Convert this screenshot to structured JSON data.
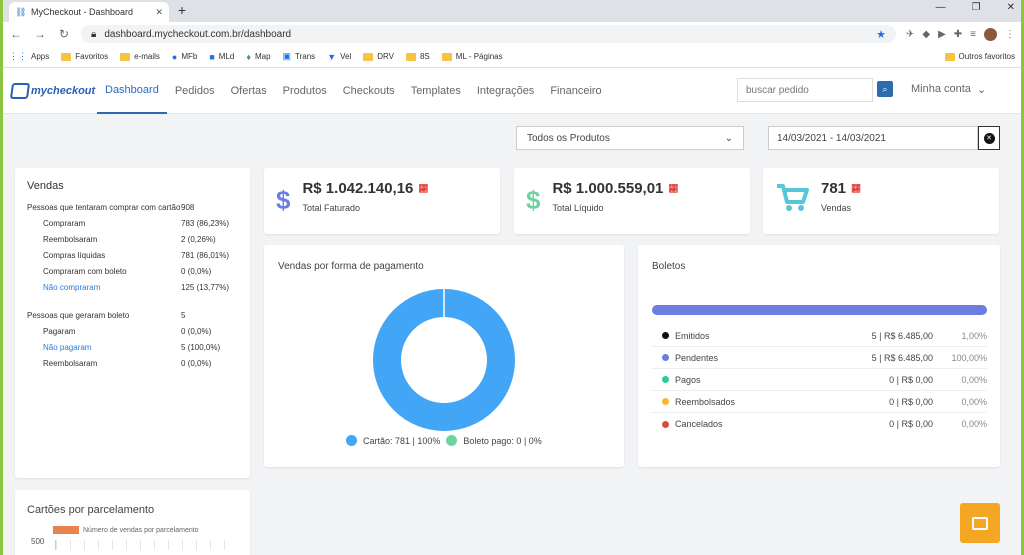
{
  "browser": {
    "tab_title": "MyCheckout - Dashboard",
    "url": "dashboard.mycheckout.com.br/dashboard",
    "bookmarks": [
      "Apps",
      "Favoritos",
      "e-mails",
      "MFb",
      "MLd",
      "Map",
      "Trans",
      "Vel",
      "DRV",
      "8S",
      "ML - Páginas"
    ],
    "bookmarks_right": "Outros favoritos"
  },
  "nav": {
    "logo": "mycheckout",
    "items": [
      "Dashboard",
      "Pedidos",
      "Ofertas",
      "Produtos",
      "Checkouts",
      "Templates",
      "Integrações",
      "Financeiro"
    ],
    "search_placeholder": "buscar pedido",
    "account": "Minha conta"
  },
  "filters": {
    "product": "Todos os Produtos",
    "date_range": "14/03/2021 - 14/03/2021"
  },
  "vendas": {
    "title": "Vendas",
    "tentaram_label": "Pessoas que tentaram comprar com cartão",
    "tentaram_value": "908",
    "compraram_label": "Compraram",
    "compraram_value": "783 (86,23%)",
    "reembolsaram_label": "Reembolsaram",
    "reembolsaram_value": "2 (0,26%)",
    "liquidas_label": "Compras líquidas",
    "liquidas_value": "781 (86,01%)",
    "comboleto_label": "Compraram com boleto",
    "comboleto_value": "0 (0,0%)",
    "naocompraram_label": "Não compraram",
    "naocompraram_value": "125 (13,77%)",
    "geraram_label": "Pessoas que geraram boleto",
    "geraram_value": "5",
    "pagaram_label": "Pagaram",
    "pagaram_value": "0 (0,0%)",
    "naopagaram_label": "Não pagaram",
    "naopagaram_value": "5 (100,0%)",
    "reemb2_label": "Reembolsaram",
    "reemb2_value": "0 (0,0%)"
  },
  "kpis": {
    "faturado_value": "R$ 1.042.140,16",
    "faturado_label": "Total Faturado",
    "liquido_value": "R$ 1.000.559,01",
    "liquido_label": "Total Líquido",
    "vendas_value": "781",
    "vendas_label": "Vendas"
  },
  "vpp": {
    "title": "Vendas por forma de pagamento",
    "cartao_legend": "Cartão: 781 | 100%",
    "boleto_legend": "Boleto pago: 0 | 0%",
    "cartao_fraction": 1.0,
    "colors": {
      "cartao": "#42a5f5",
      "boleto": "#6fd3a0"
    }
  },
  "boletos": {
    "title": "Boletos",
    "rows": [
      {
        "label": "Emitidos",
        "value": "5 | R$ 6.485,00",
        "pct": "1,00%",
        "color": "#111111"
      },
      {
        "label": "Pendentes",
        "value": "5 | R$ 6.485,00",
        "pct": "100,00%",
        "color": "#6b7fe0"
      },
      {
        "label": "Pagos",
        "value": "0 | R$ 0,00",
        "pct": "0,00%",
        "color": "#2ecc8f"
      },
      {
        "label": "Reembolsados",
        "value": "0 | R$ 0,00",
        "pct": "0,00%",
        "color": "#f5b82e"
      },
      {
        "label": "Cancelados",
        "value": "0 | R$ 0,00",
        "pct": "0,00%",
        "color": "#e0493a"
      }
    ]
  },
  "parcelamento": {
    "title": "Cartões por parcelamento",
    "legend": "Número de vendas por parcelamento",
    "ytick": "500"
  }
}
